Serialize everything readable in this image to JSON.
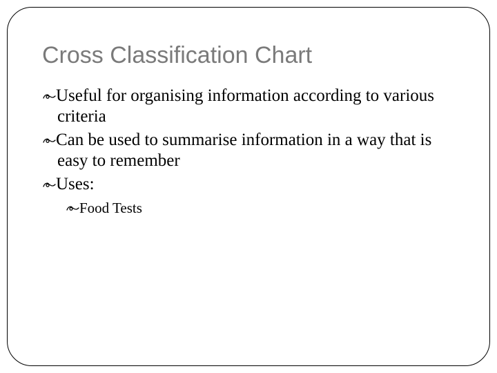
{
  "title": "Cross Classification Chart",
  "bullet_marker": "ഴ",
  "bullets": [
    "Useful for organising information according to various criteria",
    "Can be used to summarise information in a way that is easy to remember",
    "Uses:"
  ],
  "sub_bullets": [
    "Food Tests"
  ]
}
